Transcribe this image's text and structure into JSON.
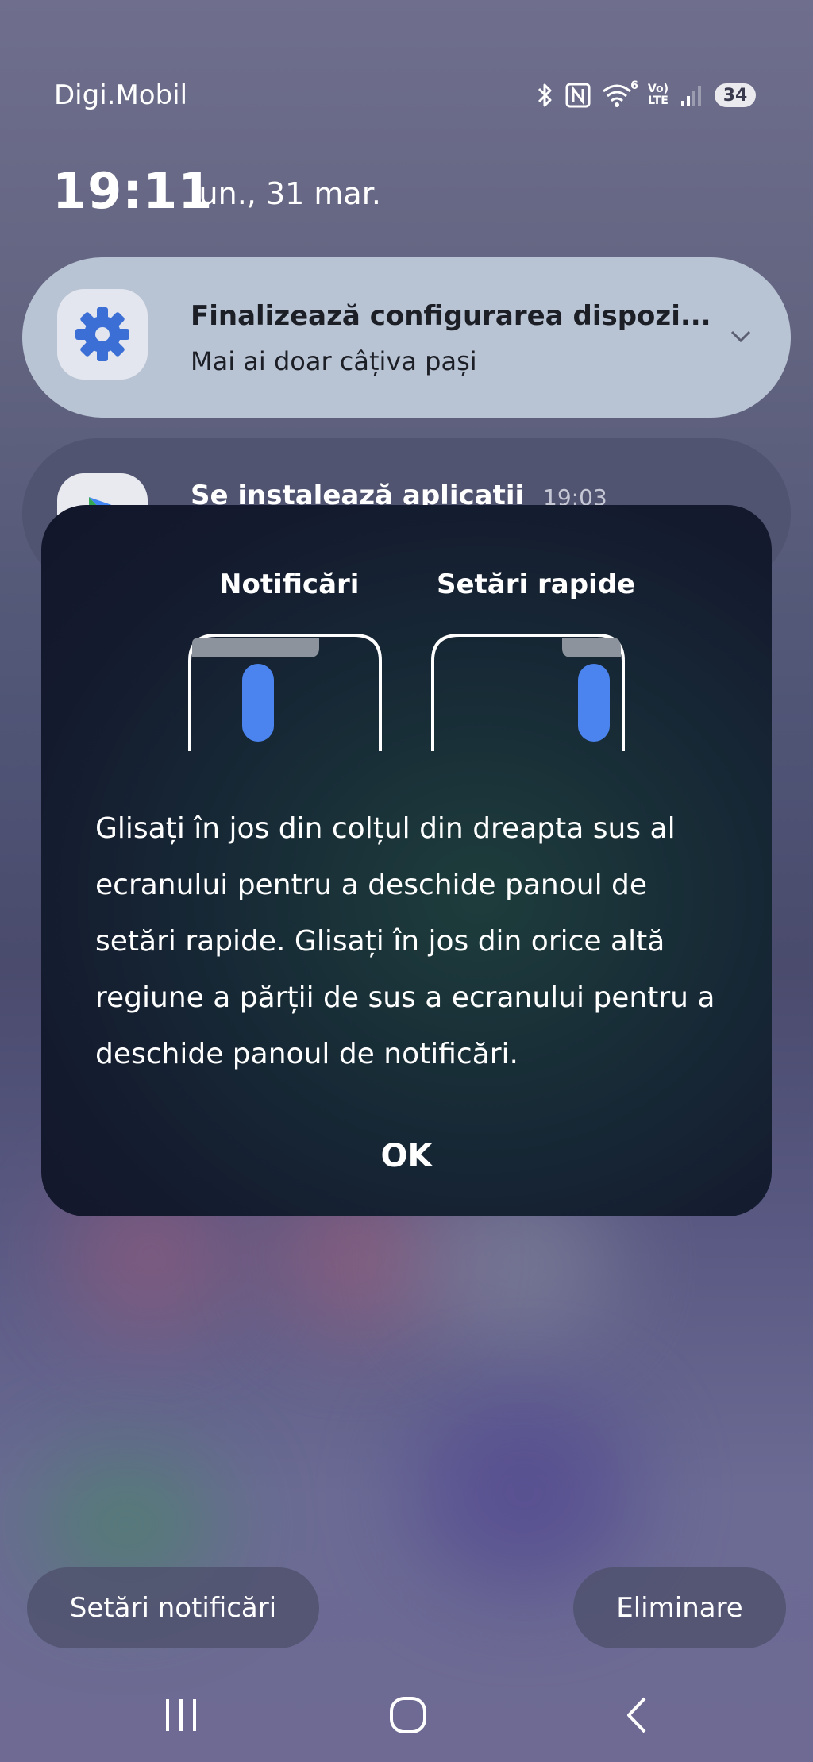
{
  "status_bar": {
    "carrier": "Digi.Mobil",
    "battery": "34",
    "network_label_top": "Vo)",
    "network_label_bottom": "LTE",
    "wifi_label": "6",
    "icons": [
      "bluetooth-icon",
      "nfc-icon",
      "wifi-icon",
      "volte-icon",
      "signal-icon",
      "battery-icon"
    ]
  },
  "clock": {
    "time": "19:11",
    "date": "lun., 31 mar."
  },
  "notifications": [
    {
      "icon": "gear-icon",
      "title": "Finalizează configurarea dispozi...",
      "subtitle": "Mai ai doar câțiva pași",
      "accent": "#3b6fd6"
    },
    {
      "icon": "play-store-icon",
      "title": "Se instalează aplicații",
      "time": "19:03"
    }
  ],
  "dialog": {
    "label_notifications": "Notificări",
    "label_quick_settings": "Setări rapide",
    "message": "Glisați în jos din colțul din dreapta sus al ecranului pentru a deschide panoul de setări rapide. Glisați în jos din orice altă regiune a părții de sus a ecranului pentru a deschide panoul de notificări.",
    "ok_label": "OK",
    "swipe_indicator_color": "#4b84ee"
  },
  "actions": {
    "notification_settings": "Setări notificări",
    "clear": "Eliminare"
  },
  "nav_bar": {
    "icons": [
      "recents-icon",
      "home-icon",
      "back-icon"
    ]
  }
}
